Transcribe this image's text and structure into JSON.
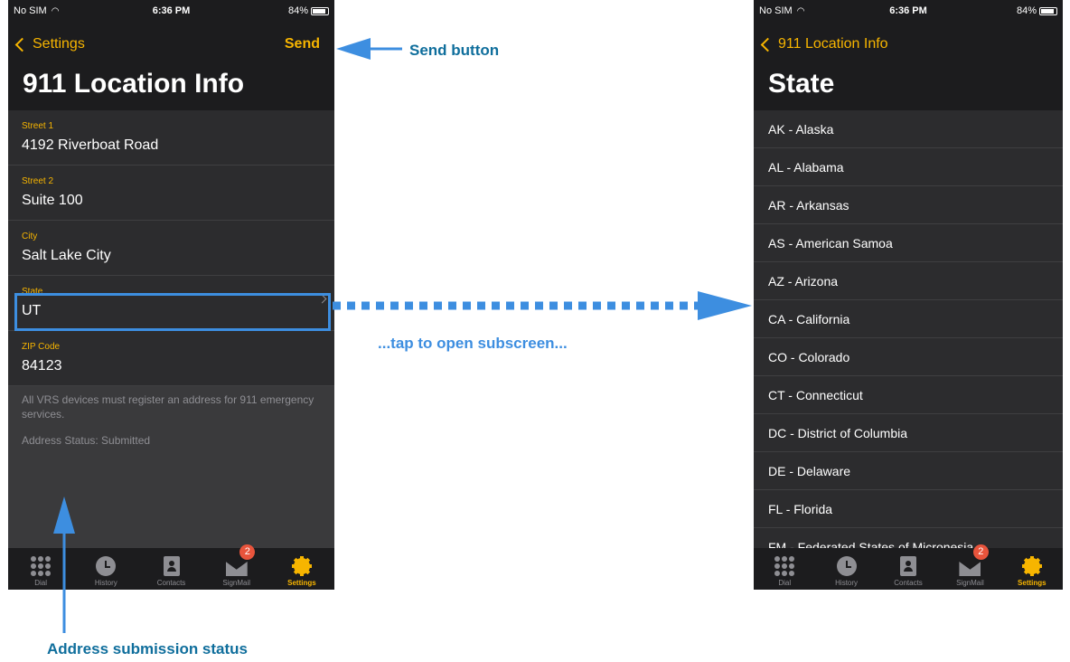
{
  "left_phone": {
    "status_bar": {
      "carrier": "No SIM",
      "time": "6:36 PM",
      "battery": "84%"
    },
    "nav": {
      "back_label": "Settings",
      "action_label": "Send",
      "title": "911 Location Info"
    },
    "fields": [
      {
        "label": "Street 1",
        "value": "4192 Riverboat Road"
      },
      {
        "label": "Street 2",
        "value": "Suite 100"
      },
      {
        "label": "City",
        "value": "Salt Lake City"
      },
      {
        "label": "State",
        "value": "UT"
      },
      {
        "label": "ZIP Code",
        "value": "84123"
      }
    ],
    "info_text": "All VRS devices must register an address for 911 emergency services.",
    "address_status": "Address Status: Submitted"
  },
  "right_phone": {
    "status_bar": {
      "carrier": "No SIM",
      "time": "6:36 PM",
      "battery": "84%"
    },
    "nav": {
      "back_label": "911 Location Info",
      "title": "State"
    },
    "states": [
      "AK - Alaska",
      "AL - Alabama",
      "AR - Arkansas",
      "AS - American Samoa",
      "AZ - Arizona",
      "CA - California",
      "CO - Colorado",
      "CT - Connecticut",
      "DC - District of Columbia",
      "DE - Delaware",
      "FL - Florida",
      "FM - Federated States of Micronesia"
    ]
  },
  "tab_bar": {
    "tabs": [
      {
        "label": "Dial",
        "icon": "dial-icon"
      },
      {
        "label": "History",
        "icon": "clock-icon"
      },
      {
        "label": "Contacts",
        "icon": "contacts-icon"
      },
      {
        "label": "SignMail",
        "icon": "mail-icon",
        "badge": "2"
      },
      {
        "label": "Settings",
        "icon": "gear-icon",
        "active": true
      }
    ]
  },
  "callouts": {
    "send": "Send button",
    "tap": "...tap to open subscreen...",
    "status": "Address submission status"
  },
  "colors": {
    "accent": "#f7b500",
    "callout_dark": "#0f6e9c",
    "callout_light": "#3d8ee0",
    "badge": "#e8543c"
  }
}
